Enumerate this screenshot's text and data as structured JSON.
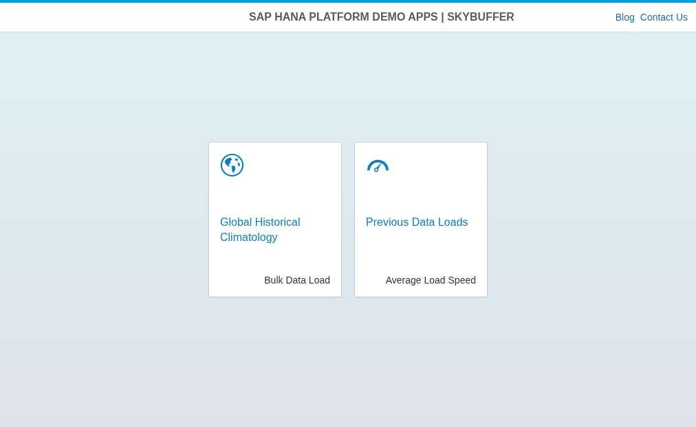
{
  "header": {
    "title": "SAP HANA PLATFORM DEMO APPS | SKYBUFFER",
    "links": [
      "Blog",
      "Contact Us"
    ]
  },
  "tiles": [
    {
      "kind": "globe",
      "title": "Global Historical Climatology",
      "footer": "Bulk Data Load"
    },
    {
      "kind": "gauge",
      "title": "Previous Data Loads",
      "footer": "Average Load Speed"
    }
  ]
}
